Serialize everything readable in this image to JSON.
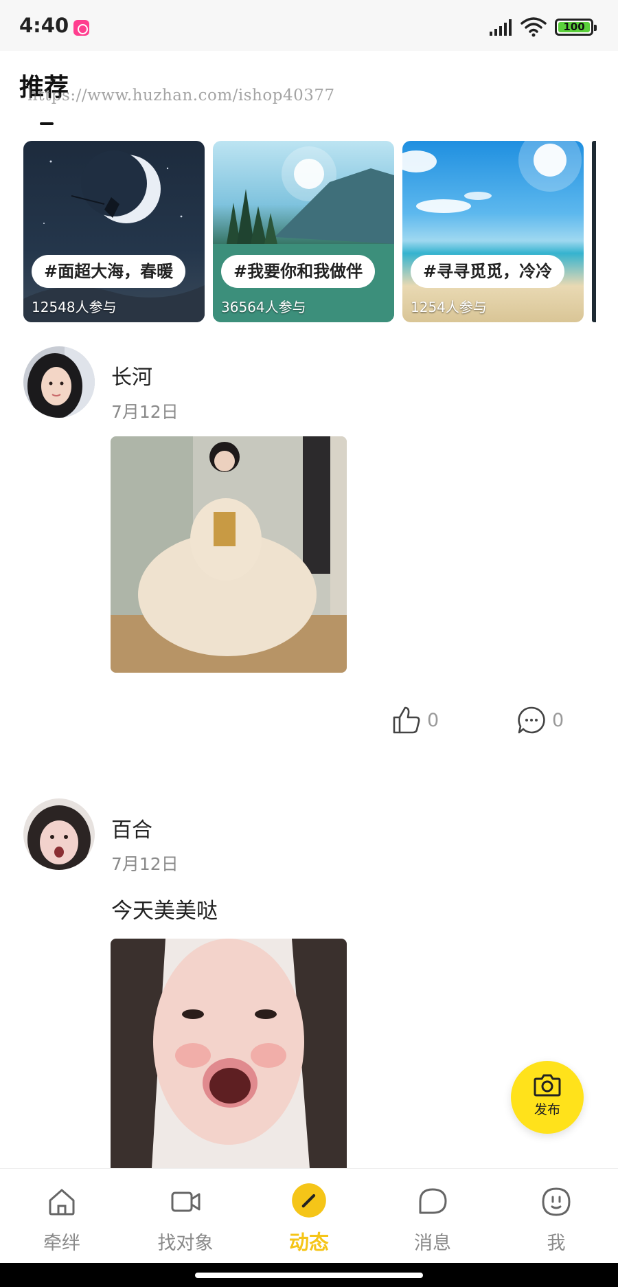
{
  "status_bar": {
    "time": "4:40",
    "battery_level": "100",
    "battery_color": "#5bd13b"
  },
  "recommend": {
    "title": "推荐",
    "watermark": "https://www.huzhan.com/ishop40377",
    "topics": [
      {
        "tag": "#面超大海，春暖",
        "count": "12548人参与"
      },
      {
        "tag": "#我要你和我做伴",
        "count": "36564人参与"
      },
      {
        "tag": "#寻寻觅觅，冷冷",
        "count": "1254人参与"
      }
    ]
  },
  "posts": [
    {
      "name": "长河",
      "date": "7月12日",
      "text": "",
      "likes": "0",
      "comments": "0"
    },
    {
      "name": "百合",
      "date": "7月12日",
      "text": "今天美美哒"
    }
  ],
  "publish_button": {
    "label": "发布",
    "color": "#ffe21b"
  },
  "bottom_nav": {
    "accent_color": "#f5c518",
    "items": [
      {
        "label": "牵绊",
        "icon": "home-icon"
      },
      {
        "label": "找对象",
        "icon": "video-camera-icon"
      },
      {
        "label": "动态",
        "icon": "pencil-icon",
        "active": true
      },
      {
        "label": "消息",
        "icon": "chat-bubble-icon"
      },
      {
        "label": "我",
        "icon": "face-icon"
      }
    ]
  }
}
